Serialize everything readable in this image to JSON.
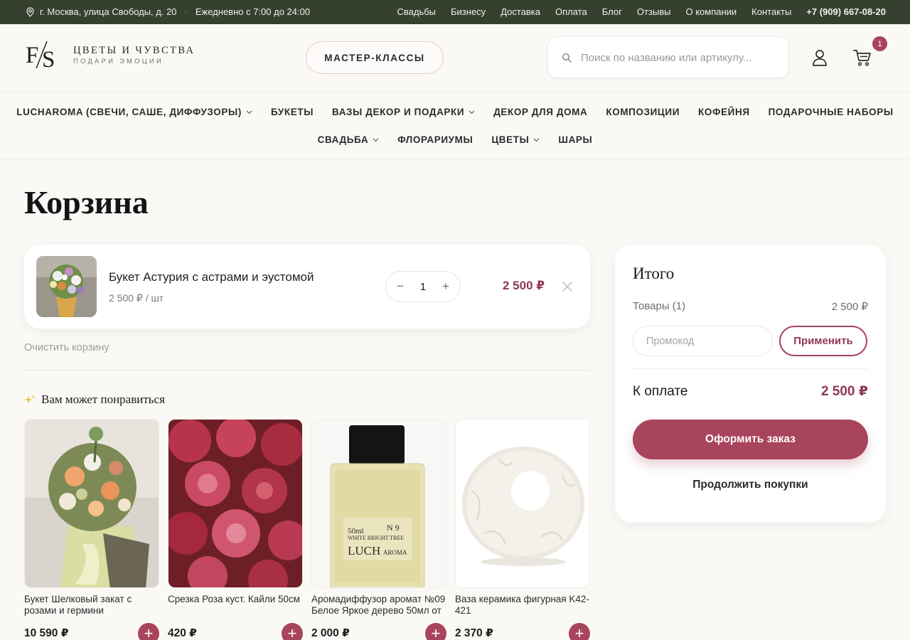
{
  "topbar": {
    "address": "г. Москва, улица Свободы, д. 20",
    "separator": "·",
    "hours": "Ежедневно с 7:00 до 24:00",
    "links": [
      "Свадьбы",
      "Бизнесу",
      "Доставка",
      "Оплата",
      "Блог",
      "Отзывы",
      "О компании",
      "Контакты"
    ],
    "phone": "+7 (909) 667-08-20",
    "icon": "location-pin-icon"
  },
  "header": {
    "logo_mark": "F/S",
    "logo_title": "ЦВЕТЫ И ЧУВСТВА",
    "logo_subtitle": "ПОДАРИ ЭМОЦИИ",
    "master_button": "МАСТЕР-КЛАССЫ",
    "search_placeholder": "Поиск по названию или артикулу...",
    "cart_count": "1"
  },
  "nav": {
    "row1": [
      {
        "label": "LUCHAROMA (СВЕЧИ, САШЕ, ДИФФУЗОРЫ)",
        "dropdown": true
      },
      {
        "label": "БУКЕТЫ",
        "dropdown": false
      },
      {
        "label": "ВАЗЫ ДЕКОР И ПОДАРКИ",
        "dropdown": true
      },
      {
        "label": "ДЕКОР ДЛЯ ДОМА",
        "dropdown": false
      },
      {
        "label": "КОМПОЗИЦИИ",
        "dropdown": false
      },
      {
        "label": "КОФЕЙНЯ",
        "dropdown": false
      },
      {
        "label": "ПОДАРОЧНЫЕ НАБОРЫ",
        "dropdown": false
      }
    ],
    "row2": [
      {
        "label": "СВАДЬБА",
        "dropdown": true
      },
      {
        "label": "ФЛОРАРИУМЫ",
        "dropdown": false
      },
      {
        "label": "ЦВЕТЫ",
        "dropdown": true
      },
      {
        "label": "ШАРЫ",
        "dropdown": false
      }
    ]
  },
  "page": {
    "title": "Корзина"
  },
  "cart": {
    "item": {
      "name": "Букет Астурия с астрами и эустомой",
      "unit_price": "2 500 ₽ / шт",
      "quantity": "1",
      "minus": "−",
      "plus": "+",
      "total": "2 500 ₽"
    },
    "clear": "Очистить корзину"
  },
  "recommendations": {
    "title": "Вам может понравиться",
    "products": [
      {
        "name": "Букет Шелковый закат с розами и гермини",
        "price": "10 590 ₽"
      },
      {
        "name": "Срезка Роза куст. Кайли 50см",
        "price": "420 ₽"
      },
      {
        "name": "Аромадиффузор аромат №09 Белое Яркое дерево 50мл от",
        "price": "2 000 ₽"
      },
      {
        "name": "Ваза керамика фигурная K42-421",
        "price": "2 370 ₽"
      }
    ],
    "add_symbol": "+"
  },
  "summary": {
    "title": "Итого",
    "goods_label": "Товары (1)",
    "goods_value": "2 500 ₽",
    "promo_placeholder": "Промокод",
    "apply": "Применить",
    "pay_label": "К оплате",
    "pay_value": "2 500 ₽",
    "checkout": "Оформить заказ",
    "continue": "Продолжить покупки"
  },
  "bottle_label": {
    "volume": "50ml",
    "number": "N 9",
    "scent": "WHITE BRIGHT TREE",
    "brand_main": "LUCH",
    "brand_tail": "AROMA"
  },
  "colors": {
    "topbar_bg": "#36402f",
    "accent": "#a9445d",
    "price": "#8f3a52",
    "page_bg": "#fbf9f6"
  }
}
